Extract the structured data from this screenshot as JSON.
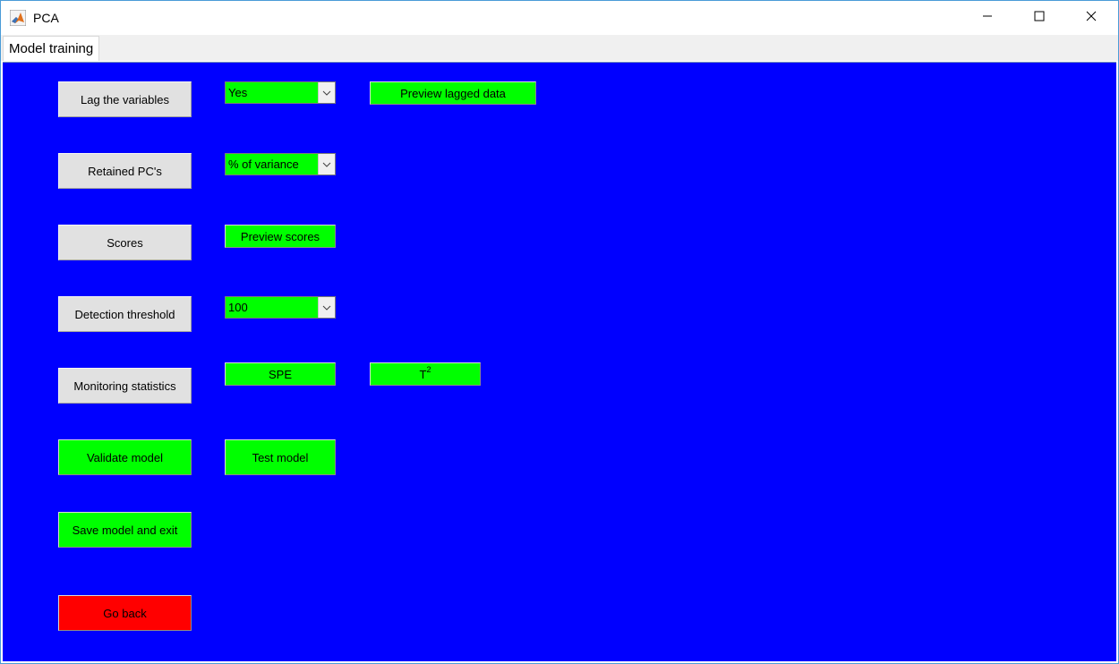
{
  "window": {
    "title": "PCA",
    "icon": "matlab-icon",
    "controls": [
      "minimize-icon",
      "maximize-icon",
      "close-icon"
    ]
  },
  "tabs": [
    {
      "label": "Model training",
      "selected": true
    }
  ],
  "colors": {
    "panel_background": "#0000ff",
    "button_green": "#00ff00",
    "button_red": "#ff0000",
    "button_gray": "#e1e1e1"
  },
  "left_buttons": {
    "lag": "Lag the variables",
    "retained": "Retained PC's",
    "scores": "Scores",
    "detection": "Detection threshold",
    "monitoring": "Monitoring statistics",
    "validate": "Validate model",
    "save": "Save model and exit",
    "go_back": "Go back"
  },
  "controls": {
    "lag_select": {
      "value": "Yes"
    },
    "preview_lagged": "Preview lagged data",
    "pc_select": {
      "value": "% of variance"
    },
    "preview_scores": "Preview scores",
    "threshold_select": {
      "value": "100"
    },
    "spe": "SPE",
    "t2": {
      "base": "T",
      "superscript": "2"
    },
    "test_model": "Test model"
  }
}
